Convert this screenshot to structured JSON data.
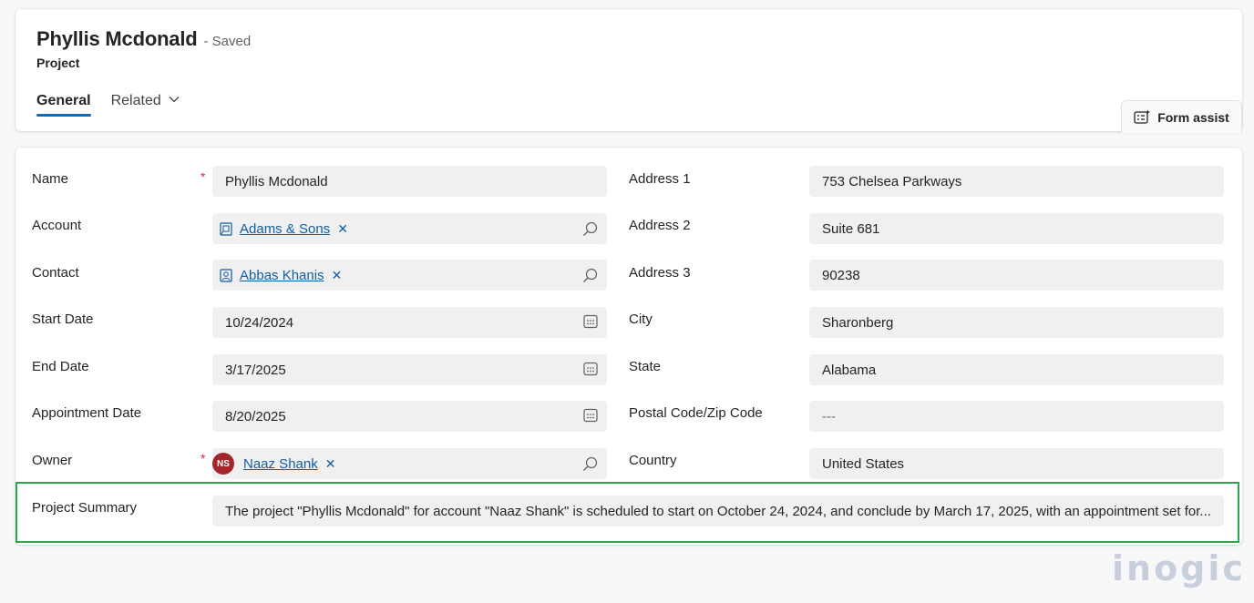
{
  "header": {
    "title": "Phyllis Mcdonald",
    "status": "- Saved",
    "entity": "Project",
    "tabs": [
      {
        "label": "General"
      },
      {
        "label": "Related"
      }
    ],
    "form_assist_label": "Form assist"
  },
  "form": {
    "left": {
      "name": {
        "label": "Name",
        "value": "Phyllis Mcdonald",
        "required": "*"
      },
      "account": {
        "label": "Account",
        "value": "Adams & Sons",
        "remove": "✕"
      },
      "contact": {
        "label": "Contact",
        "value": "Abbas Khanis",
        "remove": "✕"
      },
      "start_date": {
        "label": "Start Date",
        "value": "10/24/2024"
      },
      "end_date": {
        "label": "End Date",
        "value": "3/17/2025"
      },
      "appointment_date": {
        "label": "Appointment Date",
        "value": "8/20/2025"
      },
      "owner": {
        "label": "Owner",
        "value": "Naaz Shank",
        "initials": "NS",
        "required": "*",
        "remove": "✕"
      }
    },
    "right": {
      "address1": {
        "label": "Address 1",
        "value": "753 Chelsea Parkways"
      },
      "address2": {
        "label": "Address 2",
        "value": "Suite 681"
      },
      "address3": {
        "label": "Address 3",
        "value": "90238"
      },
      "city": {
        "label": "City",
        "value": "Sharonberg"
      },
      "state": {
        "label": "State",
        "value": "Alabama"
      },
      "postal": {
        "label": "Postal Code/Zip Code",
        "value": "---"
      },
      "country": {
        "label": "Country",
        "value": "United States"
      }
    },
    "summary": {
      "label": "Project Summary",
      "value": "The project \"Phyllis Mcdonald\" for account \"Naaz Shank\" is scheduled to start on October 24, 2024, and conclude by March 17, 2025, with an appointment set for..."
    }
  },
  "brand": {
    "name": "inogic"
  },
  "colors": {
    "accent": "#0f6cbd",
    "link": "#115ea3",
    "required": "#c4314b",
    "highlight_border": "#2ea44f",
    "avatar": "#a4262c"
  }
}
